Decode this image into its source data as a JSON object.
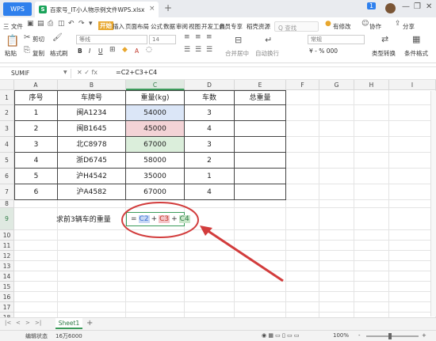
{
  "titlebar": {
    "wps_label": "WPS",
    "doc_icon": "S",
    "doc_title": "百家号_IT小人物示例文件WPS.xlsx",
    "close_glyph": "×",
    "add_glyph": "+",
    "badge": "1",
    "min_glyph": "—",
    "max_glyph": "❐",
    "win_close_glyph": "✕"
  },
  "menu": {
    "file": "三 文件",
    "start": "开始",
    "items": [
      "插入",
      "页面布局",
      "公式",
      "数据",
      "审阅",
      "视图",
      "开发工具",
      "会员专享",
      "稻壳资源"
    ],
    "search_placeholder": "Q 查找",
    "has_edit": "有修改",
    "collab": "协作",
    "share": "分享"
  },
  "ribbon": {
    "cut": "剪切",
    "copy": "复制",
    "paste": "粘贴",
    "format_painter": "格式刷",
    "font_name": "等线",
    "font_size": "14",
    "merge": "合并居中",
    "wrap": "自动换行",
    "number_format": "常规",
    "type_convert": "类型转换",
    "cond_format": "条件格式"
  },
  "formula_bar": {
    "name_box": "SUMIF",
    "fx_icons": "✕ ✓ fx",
    "formula": "=C2+C3+C4"
  },
  "grid": {
    "columns": [
      "A",
      "B",
      "C",
      "D",
      "E",
      "F",
      "G",
      "H",
      "I"
    ],
    "rows": [
      "1",
      "2",
      "3",
      "4",
      "5",
      "6",
      "7",
      "8",
      "9",
      "10",
      "11",
      "12",
      "13",
      "14",
      "15",
      "16",
      "17",
      "18"
    ],
    "headers": [
      "序号",
      "车牌号",
      "重量(kg)",
      "车数",
      "总重量"
    ],
    "data": [
      [
        "1",
        "闽A1234",
        "54000",
        "3",
        ""
      ],
      [
        "2",
        "闽B1645",
        "45000",
        "4",
        ""
      ],
      [
        "3",
        "北C8978",
        "67000",
        "3",
        ""
      ],
      [
        "4",
        "浙D6745",
        "58000",
        "2",
        ""
      ],
      [
        "5",
        "沪H4542",
        "35000",
        "1",
        ""
      ],
      [
        "6",
        "沪A4582",
        "67000",
        "4",
        ""
      ]
    ],
    "row9_label": "求前3辆车的重量",
    "edit_parts": {
      "eq": "=",
      "r1": "C2",
      "p1": "+",
      "r2": "C3",
      "p2": "+",
      "r3": "C4"
    }
  },
  "sheets": {
    "nav": [
      "|<",
      "<",
      ">",
      ">|"
    ],
    "active": "Sheet1",
    "add": "+"
  },
  "status": {
    "mode": "编辑状态",
    "value": "16万6000",
    "zoom": "100%",
    "zoom_level": 100
  },
  "colors": {
    "accent": "#2f80ed",
    "sheet_green": "#3a9b5a",
    "ref_blue": "#dbe6f7",
    "ref_red": "#f3d3d6",
    "ref_green": "#dbeedb",
    "annotation_red": "#d23c3c"
  },
  "icons": [
    "wps-logo-icon",
    "spreadsheet-file-icon",
    "close-icon",
    "add-tab-icon",
    "cut-icon",
    "copy-icon",
    "paste-icon",
    "format-painter-icon",
    "search-icon",
    "share-icon",
    "formula-fx-icon",
    "arrow-annotation"
  ]
}
